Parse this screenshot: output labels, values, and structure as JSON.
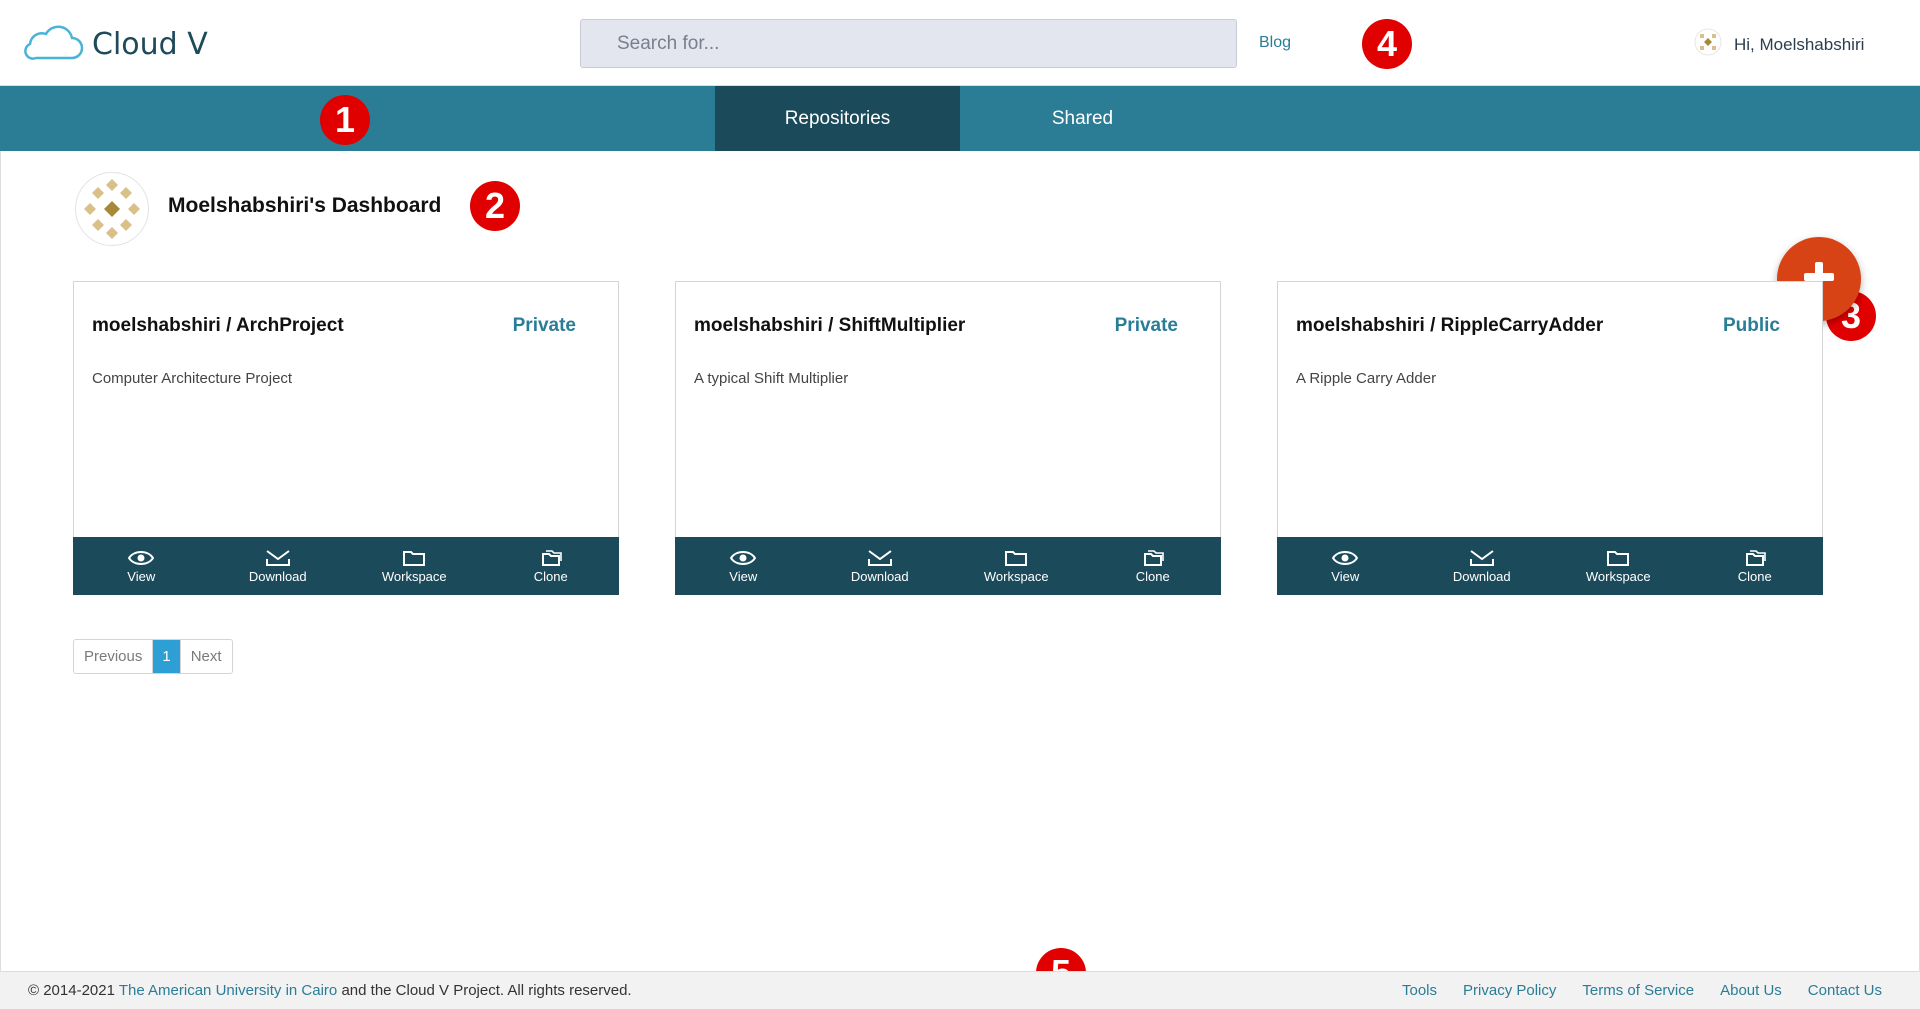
{
  "header": {
    "app_name": "Cloud V",
    "search_placeholder": "Search for...",
    "blog_label": "Blog",
    "greeting": "Hi, Moelshabshiri"
  },
  "nav": {
    "tabs": [
      {
        "label": "Repositories",
        "active": true
      },
      {
        "label": "Shared",
        "active": false
      }
    ]
  },
  "dashboard": {
    "title": "Moelshabshiri's Dashboard",
    "add_icon": "plus-icon"
  },
  "repos": [
    {
      "title": "moelshabshiri / ArchProject",
      "visibility": "Private",
      "description": "Computer Architecture Project"
    },
    {
      "title": "moelshabshiri / ShiftMultiplier",
      "visibility": "Private",
      "description": "A typical Shift Multiplier"
    },
    {
      "title": "moelshabshiri / RippleCarryAdder",
      "visibility": "Public",
      "description": "A Ripple Carry Adder"
    }
  ],
  "actions": [
    "View",
    "Download",
    "Workspace",
    "Clone"
  ],
  "pagination": {
    "previous": "Previous",
    "current": "1",
    "next": "Next"
  },
  "footer": {
    "copyright_prefix": "© 2014-2021",
    "university": "The American University in Cairo",
    "copyright_suffix": "and the Cloud V Project. All rights reserved.",
    "links": [
      "Tools",
      "Privacy Policy",
      "Terms of Service",
      "About Us",
      "Contact Us"
    ]
  },
  "annotations": [
    "1",
    "2",
    "3",
    "4",
    "5"
  ],
  "colors": {
    "primary": "#2b7c95",
    "dark": "#1b4a5a",
    "fab": "#d84315",
    "annotation": "#e00000",
    "link": "#2a7d96"
  }
}
